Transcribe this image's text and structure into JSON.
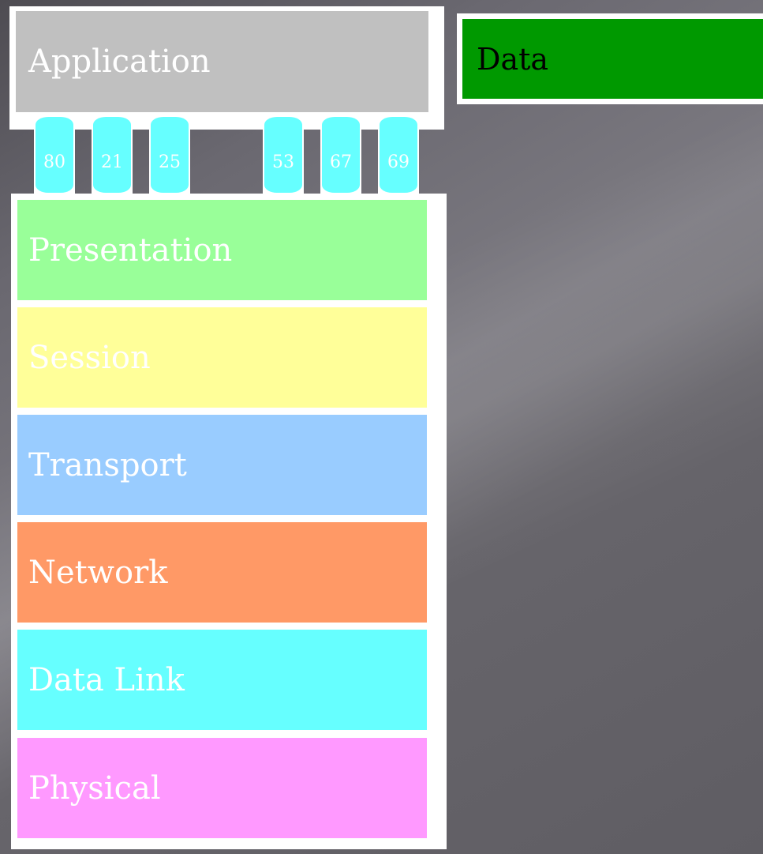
{
  "application": {
    "label": "Application",
    "color": "#c0c0c0",
    "ports": [
      {
        "number": "80"
      },
      {
        "number": "21"
      },
      {
        "number": "25"
      },
      {
        "number": "53"
      },
      {
        "number": "67"
      },
      {
        "number": "69"
      }
    ]
  },
  "layers": [
    {
      "label": "Presentation",
      "color": "#99ff99"
    },
    {
      "label": "Session",
      "color": "#ffff99"
    },
    {
      "label": "Transport",
      "color": "#99ccff"
    },
    {
      "label": "Network",
      "color": "#ff9966"
    },
    {
      "label": "Data Link",
      "color": "#66ffff"
    },
    {
      "label": "Physical",
      "color": "#ff99ff"
    }
  ],
  "data_box": {
    "label": "Data",
    "color": "#009900"
  },
  "port_color": "#66ffff"
}
